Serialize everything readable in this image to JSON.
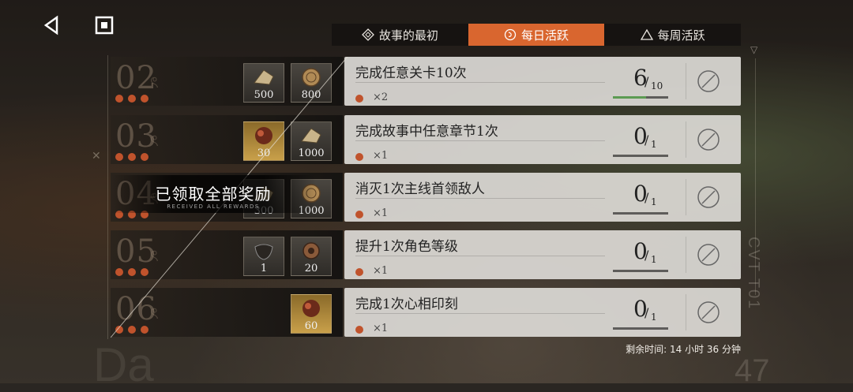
{
  "nav": {
    "back_icon": "back-triangle-icon",
    "home_icon": "home-square-icon"
  },
  "tabs": [
    {
      "label": "故事的最初",
      "icon": "diamond-icon",
      "active": false
    },
    {
      "label": "每日活跃",
      "icon": "circle-swirl-icon",
      "active": true
    },
    {
      "label": "每周活跃",
      "icon": "triangle-icon",
      "active": false
    }
  ],
  "claimed_banner": {
    "text": "已领取全部奖励",
    "subtext": "RECEIVED ALL REWARDS"
  },
  "tasks": [
    {
      "num": "02",
      "title": "完成任意关卡10次",
      "reward_mul": "×2",
      "current": "6",
      "total": "10",
      "progress": 0.6,
      "rewards": [
        {
          "count": "500",
          "icon": "shard-icon"
        },
        {
          "count": "800",
          "icon": "coin-icon"
        }
      ]
    },
    {
      "num": "03",
      "title": "完成故事中任意章节1次",
      "reward_mul": "×1",
      "current": "0",
      "total": "1",
      "progress": 0,
      "rewards": [
        {
          "count": "30",
          "icon": "orb-icon"
        },
        {
          "count": "1000",
          "icon": "shard-icon"
        }
      ]
    },
    {
      "num": "04",
      "title": "消灭1次主线首领敌人",
      "reward_mul": "×1",
      "current": "0",
      "total": "1",
      "progress": 0,
      "rewards": [
        {
          "count": "300",
          "icon": "shard-icon"
        },
        {
          "count": "1000",
          "icon": "coin-icon"
        }
      ]
    },
    {
      "num": "05",
      "title": "提升1次角色等级",
      "reward_mul": "×1",
      "current": "0",
      "total": "1",
      "progress": 0,
      "rewards": [
        {
          "count": "1",
          "icon": "mask-icon"
        },
        {
          "count": "20",
          "icon": "gear-icon"
        }
      ]
    },
    {
      "num": "06",
      "title": "完成1次心相印刻",
      "reward_mul": "×1",
      "current": "0",
      "total": "1",
      "progress": 0,
      "rewards": [
        {
          "count": "60",
          "icon": "orb-icon"
        }
      ]
    }
  ],
  "timer": "剩余时间: 14 小时 36 分钟",
  "deco": {
    "right_vertical": "CVT T01",
    "corner_number": "47",
    "corner_text": "Da"
  },
  "colors": {
    "accent": "#d9662f",
    "dot": "#c0532c",
    "progress": "#5c9b52"
  }
}
